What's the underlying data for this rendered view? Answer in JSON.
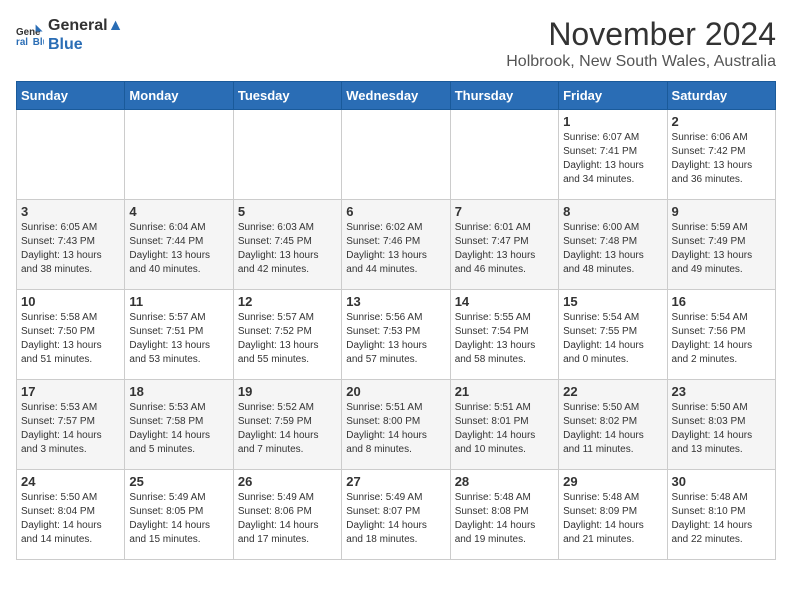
{
  "header": {
    "logo_line1": "General",
    "logo_line2": "Blue",
    "title": "November 2024",
    "subtitle": "Holbrook, New South Wales, Australia"
  },
  "days_of_week": [
    "Sunday",
    "Monday",
    "Tuesday",
    "Wednesday",
    "Thursday",
    "Friday",
    "Saturday"
  ],
  "weeks": [
    [
      {
        "day": "",
        "info": ""
      },
      {
        "day": "",
        "info": ""
      },
      {
        "day": "",
        "info": ""
      },
      {
        "day": "",
        "info": ""
      },
      {
        "day": "",
        "info": ""
      },
      {
        "day": "1",
        "info": "Sunrise: 6:07 AM\nSunset: 7:41 PM\nDaylight: 13 hours\nand 34 minutes."
      },
      {
        "day": "2",
        "info": "Sunrise: 6:06 AM\nSunset: 7:42 PM\nDaylight: 13 hours\nand 36 minutes."
      }
    ],
    [
      {
        "day": "3",
        "info": "Sunrise: 6:05 AM\nSunset: 7:43 PM\nDaylight: 13 hours\nand 38 minutes."
      },
      {
        "day": "4",
        "info": "Sunrise: 6:04 AM\nSunset: 7:44 PM\nDaylight: 13 hours\nand 40 minutes."
      },
      {
        "day": "5",
        "info": "Sunrise: 6:03 AM\nSunset: 7:45 PM\nDaylight: 13 hours\nand 42 minutes."
      },
      {
        "day": "6",
        "info": "Sunrise: 6:02 AM\nSunset: 7:46 PM\nDaylight: 13 hours\nand 44 minutes."
      },
      {
        "day": "7",
        "info": "Sunrise: 6:01 AM\nSunset: 7:47 PM\nDaylight: 13 hours\nand 46 minutes."
      },
      {
        "day": "8",
        "info": "Sunrise: 6:00 AM\nSunset: 7:48 PM\nDaylight: 13 hours\nand 48 minutes."
      },
      {
        "day": "9",
        "info": "Sunrise: 5:59 AM\nSunset: 7:49 PM\nDaylight: 13 hours\nand 49 minutes."
      }
    ],
    [
      {
        "day": "10",
        "info": "Sunrise: 5:58 AM\nSunset: 7:50 PM\nDaylight: 13 hours\nand 51 minutes."
      },
      {
        "day": "11",
        "info": "Sunrise: 5:57 AM\nSunset: 7:51 PM\nDaylight: 13 hours\nand 53 minutes."
      },
      {
        "day": "12",
        "info": "Sunrise: 5:57 AM\nSunset: 7:52 PM\nDaylight: 13 hours\nand 55 minutes."
      },
      {
        "day": "13",
        "info": "Sunrise: 5:56 AM\nSunset: 7:53 PM\nDaylight: 13 hours\nand 57 minutes."
      },
      {
        "day": "14",
        "info": "Sunrise: 5:55 AM\nSunset: 7:54 PM\nDaylight: 13 hours\nand 58 minutes."
      },
      {
        "day": "15",
        "info": "Sunrise: 5:54 AM\nSunset: 7:55 PM\nDaylight: 14 hours\nand 0 minutes."
      },
      {
        "day": "16",
        "info": "Sunrise: 5:54 AM\nSunset: 7:56 PM\nDaylight: 14 hours\nand 2 minutes."
      }
    ],
    [
      {
        "day": "17",
        "info": "Sunrise: 5:53 AM\nSunset: 7:57 PM\nDaylight: 14 hours\nand 3 minutes."
      },
      {
        "day": "18",
        "info": "Sunrise: 5:53 AM\nSunset: 7:58 PM\nDaylight: 14 hours\nand 5 minutes."
      },
      {
        "day": "19",
        "info": "Sunrise: 5:52 AM\nSunset: 7:59 PM\nDaylight: 14 hours\nand 7 minutes."
      },
      {
        "day": "20",
        "info": "Sunrise: 5:51 AM\nSunset: 8:00 PM\nDaylight: 14 hours\nand 8 minutes."
      },
      {
        "day": "21",
        "info": "Sunrise: 5:51 AM\nSunset: 8:01 PM\nDaylight: 14 hours\nand 10 minutes."
      },
      {
        "day": "22",
        "info": "Sunrise: 5:50 AM\nSunset: 8:02 PM\nDaylight: 14 hours\nand 11 minutes."
      },
      {
        "day": "23",
        "info": "Sunrise: 5:50 AM\nSunset: 8:03 PM\nDaylight: 14 hours\nand 13 minutes."
      }
    ],
    [
      {
        "day": "24",
        "info": "Sunrise: 5:50 AM\nSunset: 8:04 PM\nDaylight: 14 hours\nand 14 minutes."
      },
      {
        "day": "25",
        "info": "Sunrise: 5:49 AM\nSunset: 8:05 PM\nDaylight: 14 hours\nand 15 minutes."
      },
      {
        "day": "26",
        "info": "Sunrise: 5:49 AM\nSunset: 8:06 PM\nDaylight: 14 hours\nand 17 minutes."
      },
      {
        "day": "27",
        "info": "Sunrise: 5:49 AM\nSunset: 8:07 PM\nDaylight: 14 hours\nand 18 minutes."
      },
      {
        "day": "28",
        "info": "Sunrise: 5:48 AM\nSunset: 8:08 PM\nDaylight: 14 hours\nand 19 minutes."
      },
      {
        "day": "29",
        "info": "Sunrise: 5:48 AM\nSunset: 8:09 PM\nDaylight: 14 hours\nand 21 minutes."
      },
      {
        "day": "30",
        "info": "Sunrise: 5:48 AM\nSunset: 8:10 PM\nDaylight: 14 hours\nand 22 minutes."
      }
    ]
  ]
}
